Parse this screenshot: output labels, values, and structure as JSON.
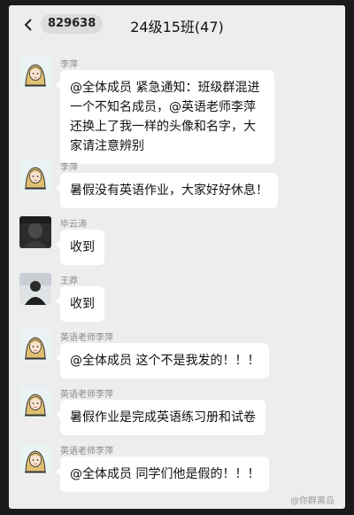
{
  "header": {
    "back_icon": "chevron-left-icon",
    "unread_badge": "829638",
    "chat_title": "24级15班(47)"
  },
  "messages": [
    {
      "sender": "李萍",
      "avatar": "cartoon-girl-avatar",
      "text": "@全体成员 紧急通知：班级群混进一个不知名成员，@英语老师李萍还换上了我一样的头像和名字，大家请注意辨别"
    },
    {
      "sender": "李萍",
      "avatar": "cartoon-girl-avatar",
      "text": "暑假没有英语作业，大家好好休息！"
    },
    {
      "sender": "毕云涛",
      "avatar": "dark-photo-avatar",
      "text": "收到"
    },
    {
      "sender": "王莽",
      "avatar": "person-photo-avatar",
      "text": "收到"
    },
    {
      "sender": "英语老师李萍",
      "avatar": "cartoon-girl-avatar",
      "text": "@全体成员 这个不是我发的！！！"
    },
    {
      "sender": "英语老师李萍",
      "avatar": "cartoon-girl-avatar",
      "text": "暑假作业是完成英语练习册和试卷"
    },
    {
      "sender": "英语老师李萍",
      "avatar": "cartoon-girl-avatar",
      "text": "@全体成员 同学们他是假的！！！"
    }
  ],
  "watermark": "@你群离岛",
  "colors": {
    "chat_background": "#ededed",
    "bubble": "#ffffff",
    "sender_name": "#8a8a8a"
  }
}
